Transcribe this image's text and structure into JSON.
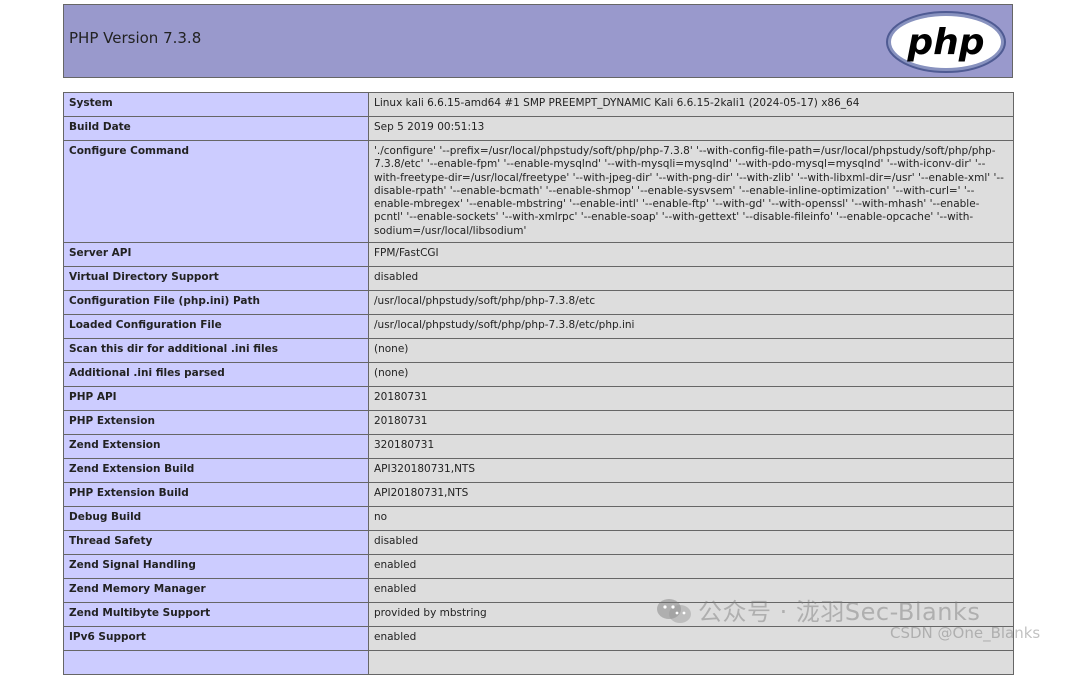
{
  "header": {
    "title": "PHP Version 7.3.8",
    "logo_text": "php",
    "logo_color": "#6f72b0"
  },
  "rows": [
    {
      "label": "System",
      "value": "Linux kali 6.6.15-amd64 #1 SMP PREEMPT_DYNAMIC Kali 6.6.15-2kali1 (2024-05-17) x86_64"
    },
    {
      "label": "Build Date",
      "value": "Sep 5 2019 00:51:13"
    },
    {
      "label": "Configure Command",
      "value": "'./configure' '--prefix=/usr/local/phpstudy/soft/php/php-7.3.8' '--with-config-file-path=/usr/local/phpstudy/soft/php/php-7.3.8/etc' '--enable-fpm' '--enable-mysqlnd' '--with-mysqli=mysqlnd' '--with-pdo-mysql=mysqlnd' '--with-iconv-dir' '--with-freetype-dir=/usr/local/freetype' '--with-jpeg-dir' '--with-png-dir' '--with-zlib' '--with-libxml-dir=/usr' '--enable-xml' '--disable-rpath' '--enable-bcmath' '--enable-shmop' '--enable-sysvsem' '--enable-inline-optimization' '--with-curl=' '--enable-mbregex' '--enable-mbstring' '--enable-intl' '--enable-ftp' '--with-gd' '--with-openssl' '--with-mhash' '--enable-pcntl' '--enable-sockets' '--with-xmlrpc' '--enable-soap' '--with-gettext' '--disable-fileinfo' '--enable-opcache' '--with-sodium=/usr/local/libsodium'"
    },
    {
      "label": "Server API",
      "value": "FPM/FastCGI"
    },
    {
      "label": "Virtual Directory Support",
      "value": "disabled"
    },
    {
      "label": "Configuration File (php.ini) Path",
      "value": "/usr/local/phpstudy/soft/php/php-7.3.8/etc"
    },
    {
      "label": "Loaded Configuration File",
      "value": "/usr/local/phpstudy/soft/php/php-7.3.8/etc/php.ini"
    },
    {
      "label": "Scan this dir for additional .ini files",
      "value": "(none)"
    },
    {
      "label": "Additional .ini files parsed",
      "value": "(none)"
    },
    {
      "label": "PHP API",
      "value": "20180731"
    },
    {
      "label": "PHP Extension",
      "value": "20180731"
    },
    {
      "label": "Zend Extension",
      "value": "320180731"
    },
    {
      "label": "Zend Extension Build",
      "value": "API320180731,NTS"
    },
    {
      "label": "PHP Extension Build",
      "value": "API20180731,NTS"
    },
    {
      "label": "Debug Build",
      "value": "no"
    },
    {
      "label": "Thread Safety",
      "value": "disabled"
    },
    {
      "label": "Zend Signal Handling",
      "value": "enabled"
    },
    {
      "label": "Zend Memory Manager",
      "value": "enabled"
    },
    {
      "label": "Zend Multibyte Support",
      "value": "provided by mbstring"
    },
    {
      "label": "IPv6 Support",
      "value": "enabled"
    },
    {
      "label": "",
      "value": ""
    }
  ],
  "watermarks": {
    "line1": "公众号 · 泷羽Sec-Blanks",
    "line2": "CSDN @One_Blanks"
  }
}
